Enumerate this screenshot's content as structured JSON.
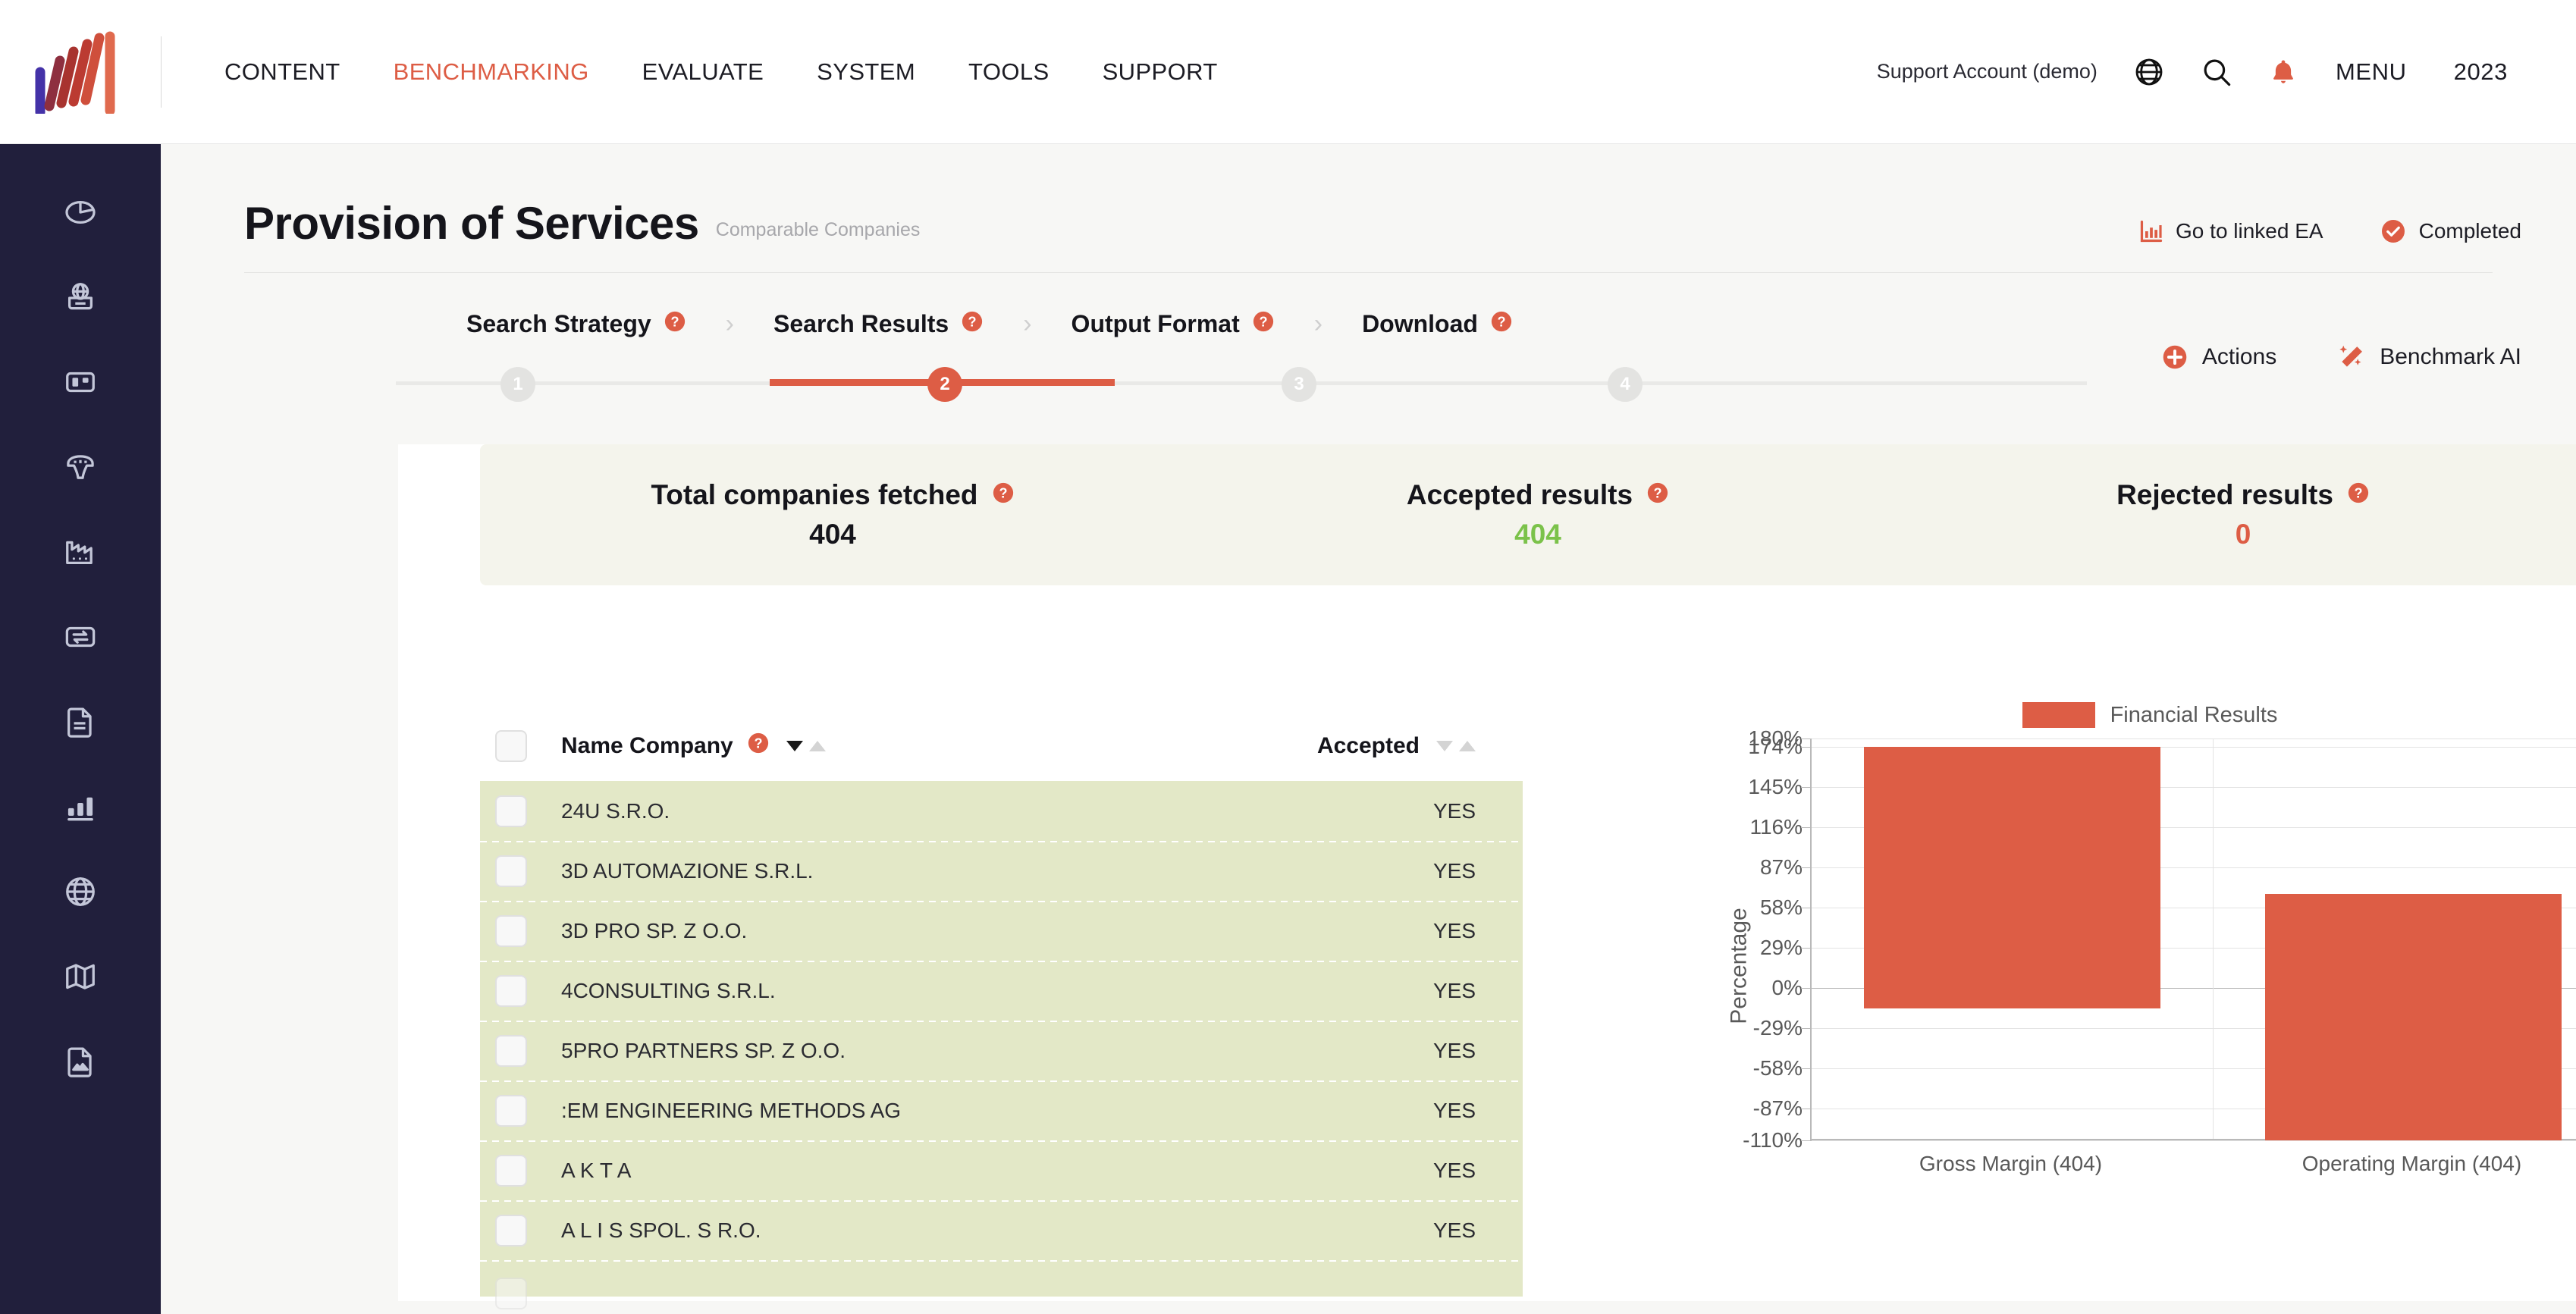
{
  "header": {
    "logo_name": "benchmark-logo",
    "nav": [
      {
        "label": "CONTENT",
        "active": false
      },
      {
        "label": "BENCHMARKING",
        "active": true
      },
      {
        "label": "EVALUATE",
        "active": false
      },
      {
        "label": "SYSTEM",
        "active": false
      },
      {
        "label": "TOOLS",
        "active": false
      },
      {
        "label": "SUPPORT",
        "active": false
      }
    ],
    "account": "Support Account (demo)",
    "menu_label": "MENU",
    "year": "2023",
    "icons": [
      "globe-icon",
      "search-icon",
      "bell-icon"
    ]
  },
  "sidebar": {
    "items": [
      {
        "icon": "pie-chart-icon"
      },
      {
        "icon": "globe-card-icon"
      },
      {
        "icon": "board-icon"
      },
      {
        "icon": "bridge-icon"
      },
      {
        "icon": "factory-icon"
      },
      {
        "icon": "transfer-icon"
      },
      {
        "icon": "document-icon"
      },
      {
        "icon": "bar-chart-icon"
      },
      {
        "icon": "globe-grid-icon"
      },
      {
        "icon": "map-icon"
      },
      {
        "icon": "image-file-icon"
      }
    ]
  },
  "page": {
    "title": "Provision of Services",
    "subtitle": "Comparable Companies",
    "linked_ea_label": "Go to linked EA",
    "status_label": "Completed",
    "accent": "#dd5d45"
  },
  "steps": {
    "items": [
      {
        "label": "Search Strategy",
        "number": "1",
        "active": false
      },
      {
        "label": "Search Results",
        "number": "2",
        "active": true
      },
      {
        "label": "Output Format",
        "number": "3",
        "active": false
      },
      {
        "label": "Download",
        "number": "4",
        "active": false
      }
    ],
    "separator": "›",
    "actions_label": "Actions",
    "benchmark_ai_label": "Benchmark AI"
  },
  "stats": [
    {
      "label": "Total companies fetched",
      "value": "404",
      "tone": ""
    },
    {
      "label": "Accepted results",
      "value": "404",
      "tone": "green"
    },
    {
      "label": "Rejected results",
      "value": "0",
      "tone": "red"
    }
  ],
  "table": {
    "columns": {
      "name": "Name Company",
      "accepted": "Accepted"
    },
    "rows": [
      {
        "name": "24U S.R.O.",
        "accepted": "YES"
      },
      {
        "name": "3D AUTOMAZIONE S.R.L.",
        "accepted": "YES"
      },
      {
        "name": "3D PRO SP. Z O.O.",
        "accepted": "YES"
      },
      {
        "name": "4CONSULTING S.R.L.",
        "accepted": "YES"
      },
      {
        "name": "5PRO PARTNERS SP. Z O.O.",
        "accepted": "YES"
      },
      {
        "name": ":EM ENGINEERING METHODS AG",
        "accepted": "YES"
      },
      {
        "name": "A K T A",
        "accepted": "YES"
      },
      {
        "name": "A L I S SPOL. S R.O.",
        "accepted": "YES"
      }
    ]
  },
  "chart_data": {
    "type": "bar",
    "title": "",
    "subtitle": "",
    "xlabel": "",
    "ylabel": "Percentage",
    "legend": [
      "Financial Results"
    ],
    "legend_position": "top-center",
    "legend_color": "#dd5d45",
    "grid": true,
    "categories": [
      "Gross Margin (404)",
      "Operating Margin (404)"
    ],
    "ylim": [
      -110,
      180
    ],
    "ytick_labels": [
      "180%",
      "174%",
      "145%",
      "116%",
      "87%",
      "58%",
      "29%",
      "0%",
      "-29%",
      "-58%",
      "-87%",
      "-110%"
    ],
    "yticks": [
      180,
      174,
      145,
      116,
      87,
      58,
      29,
      0,
      -29,
      -58,
      -87,
      -110
    ],
    "series": [
      {
        "name": "Financial Results",
        "kind": "range",
        "low": [
          -15,
          -110
        ],
        "high": [
          174,
          68
        ]
      }
    ]
  }
}
